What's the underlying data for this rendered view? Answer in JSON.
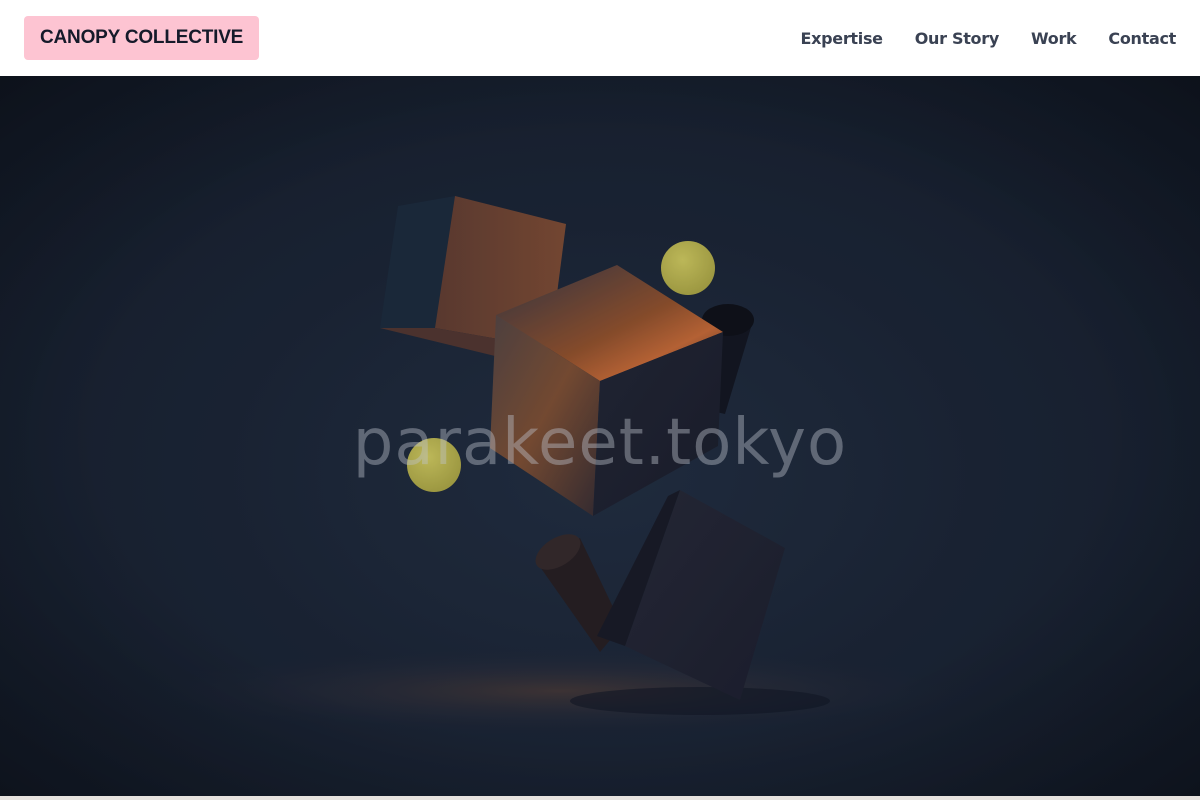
{
  "header": {
    "logo_text": "CANOPY COLLECTIVE",
    "nav": [
      {
        "label": "Expertise"
      },
      {
        "label": "Our Story"
      },
      {
        "label": "Work"
      },
      {
        "label": "Contact"
      }
    ]
  },
  "hero": {
    "watermark_text": "parakeet.tokyo",
    "image_subject": "floating 3d cubes, cylinders and yellow spheres"
  },
  "colors": {
    "logo_bg": "#fdc4d2",
    "header_bg": "#ffffff",
    "nav_text": "#3a4253",
    "hero_bg": "#1d2738",
    "accent_orange": "#d9733a",
    "sphere_yellow": "#d8d25a"
  }
}
